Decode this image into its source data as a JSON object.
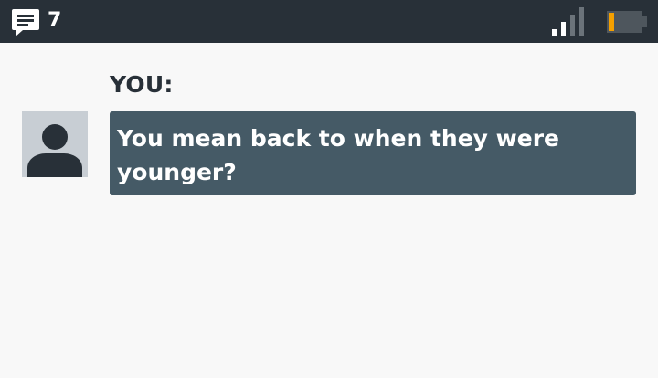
{
  "status_bar": {
    "message_icon": "chat-bubble-icon",
    "message_count": "7",
    "signal_icon": "signal-strength-icon",
    "battery_icon": "battery-low-icon",
    "battery_color": "#f5a000"
  },
  "conversation": {
    "speaker": "YOU:",
    "avatar_icon": "person-avatar-icon",
    "message": "You mean back to when they were younger?"
  },
  "colors": {
    "status_bar_bg": "#283038",
    "bubble_bg": "#455a66",
    "page_bg": "#f8f8f8",
    "avatar_bg": "#c8ced4"
  }
}
